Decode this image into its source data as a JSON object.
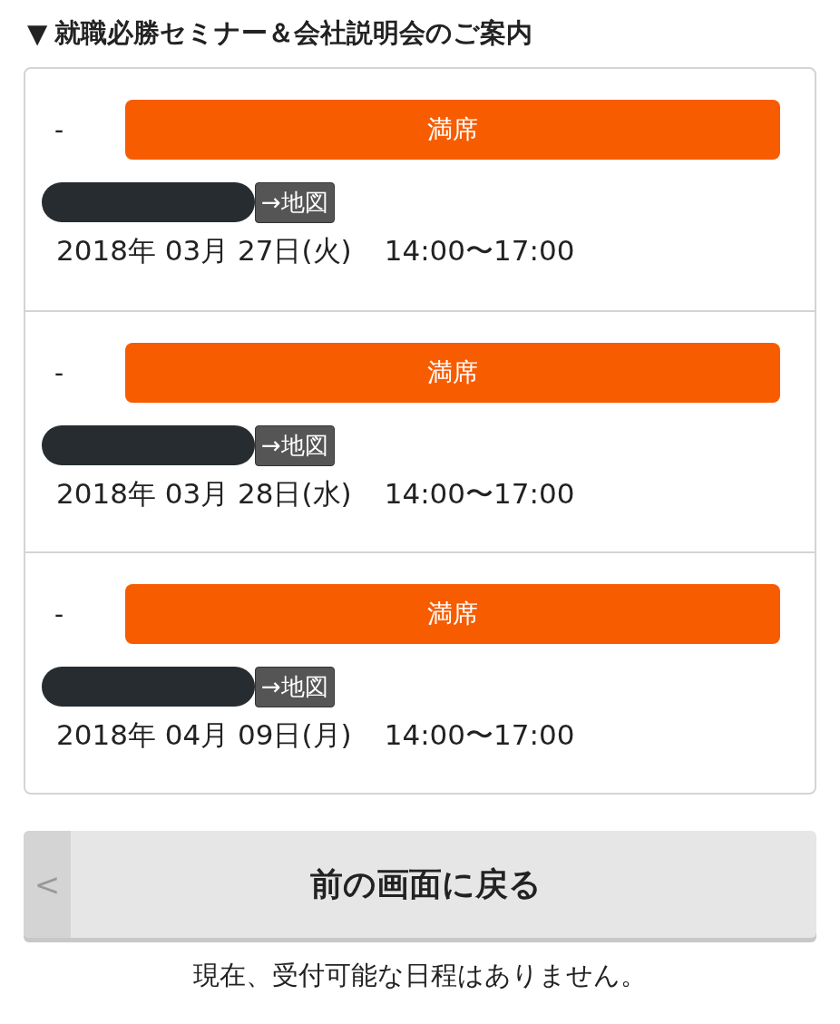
{
  "heading": {
    "marker": "▼",
    "title": "就職必勝セミナー＆会社説明会のご案内"
  },
  "sessions": [
    {
      "dash": "-",
      "status": "満席",
      "map_link": "→地図",
      "date": "2018年 03月 27日(火)",
      "time": "14:00〜17:00"
    },
    {
      "dash": "-",
      "status": "満席",
      "map_link": "→地図",
      "date": "2018年 03月 28日(水)",
      "time": "14:00〜17:00"
    },
    {
      "dash": "-",
      "status": "満席",
      "map_link": "→地図",
      "date": "2018年 04月 09日(月)",
      "time": "14:00〜17:00"
    }
  ],
  "back_button": {
    "arrow": "<",
    "label": "前の画面に戻る"
  },
  "notice": "現在、受付可能な日程はありません。"
}
